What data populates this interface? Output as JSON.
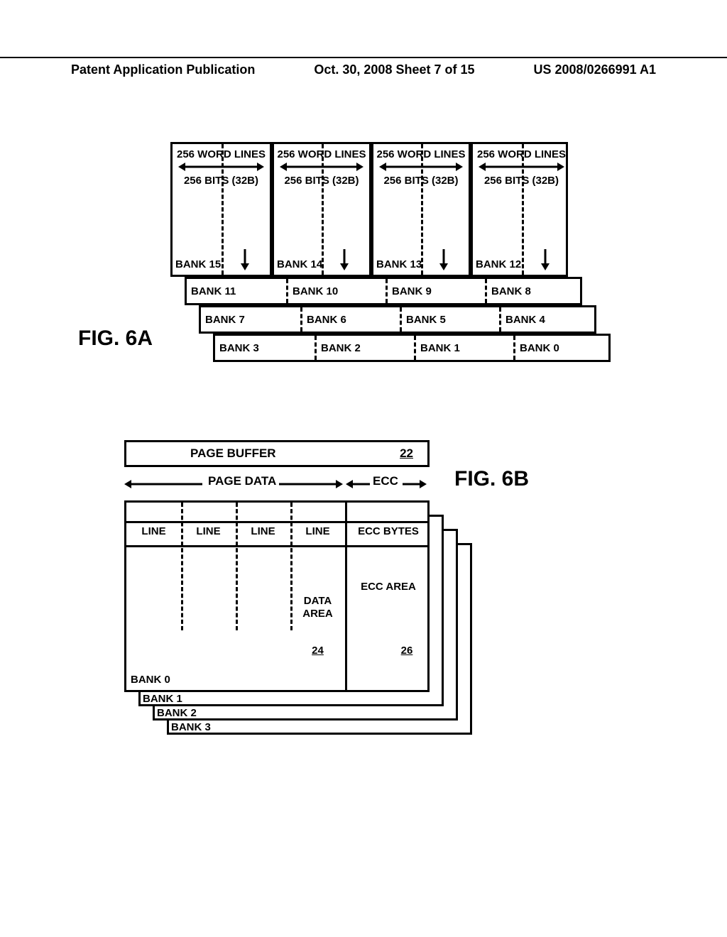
{
  "header": {
    "left": "Patent Application Publication",
    "mid": "Oct. 30, 2008  Sheet 7 of 15",
    "right": "US 2008/0266991 A1"
  },
  "fig6a": {
    "label": "FIG. 6A",
    "wordlines": "256 WORD LINES",
    "bits": "256 BITS (32B)",
    "top_banks": [
      "BANK 15",
      "BANK 14",
      "BANK 13",
      "BANK 12"
    ],
    "layer2": [
      "BANK 11",
      "BANK 10",
      "BANK 9",
      "BANK 8"
    ],
    "layer3": [
      "BANK 7",
      "BANK 6",
      "BANK 5",
      "BANK 4"
    ],
    "layer4": [
      "BANK 3",
      "BANK 2",
      "BANK 1",
      "BANK 0"
    ]
  },
  "fig6b": {
    "label": "FIG. 6B",
    "page_buffer": "PAGE BUFFER",
    "page_buffer_ref": "22",
    "page_data_label": "PAGE DATA",
    "ecc_label": "ECC",
    "line": "LINE",
    "ecc_bytes": "ECC BYTES",
    "data_area": "DATA AREA",
    "data_area_ref": "24",
    "ecc_area": "ECC AREA",
    "ecc_area_ref": "26",
    "banks": [
      "BANK 0",
      "BANK 1",
      "BANK 2",
      "BANK 3"
    ]
  }
}
